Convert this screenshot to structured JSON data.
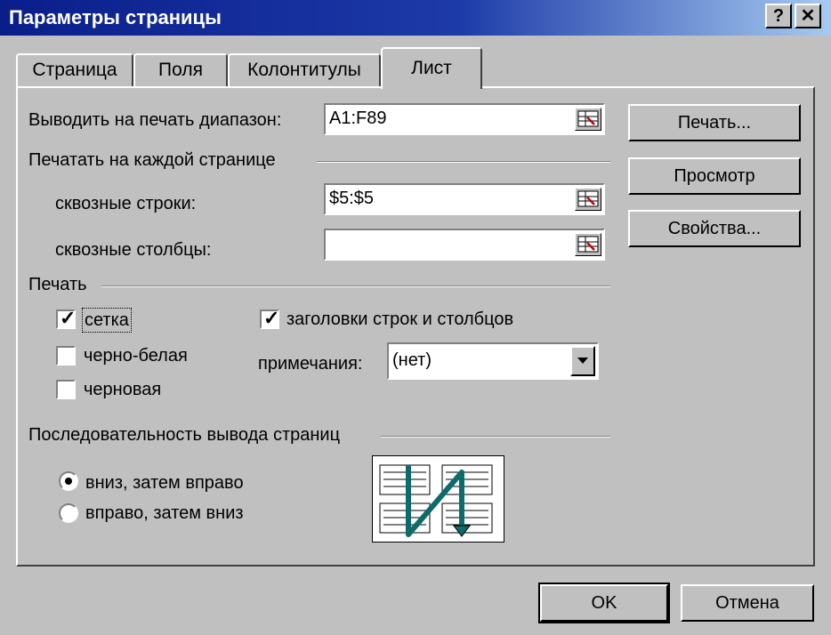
{
  "window": {
    "title": "Параметры страницы",
    "help_btn": "?",
    "close_btn": "✕"
  },
  "tabs": [
    {
      "label": "Страница",
      "active": false
    },
    {
      "label": "Поля",
      "active": false
    },
    {
      "label": "Колонтитулы",
      "active": false
    },
    {
      "label": "Лист",
      "active": true
    }
  ],
  "print_area": {
    "label": "Выводить на печать диапазон:",
    "value": "A1:F89"
  },
  "print_titles": {
    "heading": "Печатать на каждой странице",
    "rows_label": "сквозные строки:",
    "rows_value": "$5:$5",
    "cols_label": "сквозные столбцы:",
    "cols_value": ""
  },
  "print": {
    "heading": "Печать",
    "gridlines": {
      "label": "сетка",
      "checked": true
    },
    "black_white": {
      "label": "черно-белая",
      "checked": false
    },
    "draft": {
      "label": "черновая",
      "checked": false
    },
    "headings": {
      "label": "заголовки строк и столбцов",
      "checked": true
    },
    "comments_label": "примечания:",
    "comments_value": "(нет)"
  },
  "page_order": {
    "heading": "Последовательность вывода страниц",
    "down_then_over": {
      "label": "вниз, затем вправо",
      "selected": true
    },
    "over_then_down": {
      "label": "вправо, затем вниз",
      "selected": false
    }
  },
  "side_buttons": {
    "print": "Печать...",
    "preview": "Просмотр",
    "properties": "Свойства..."
  },
  "footer": {
    "ok": "OK",
    "cancel": "Отмена"
  },
  "colors": {
    "title_start": "#0a1e8a",
    "title_end": "#a6caf0",
    "face": "#c0c0c0",
    "order_arrow": "#0e6b6b"
  }
}
